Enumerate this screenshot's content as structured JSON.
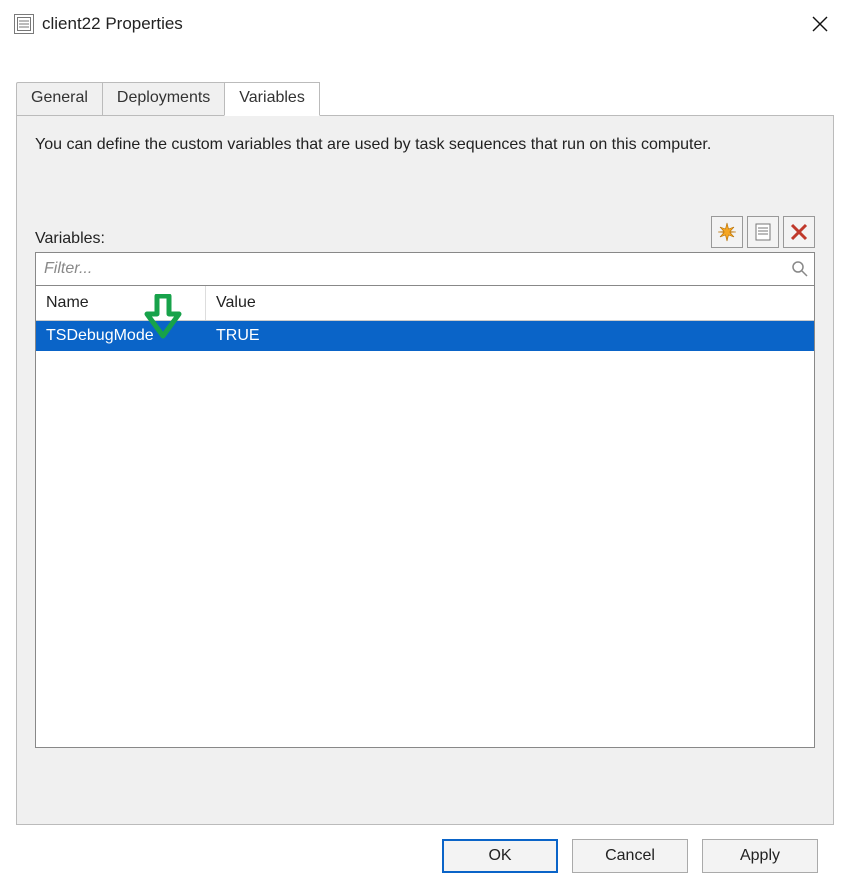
{
  "window": {
    "title": "client22 Properties"
  },
  "tabs": {
    "general": "General",
    "deployments": "Deployments",
    "variables": "Variables",
    "active": "variables"
  },
  "variables_tab": {
    "description": "You can define the custom variables that are used by task sequences that run on this computer.",
    "section_label": "Variables:",
    "filter_placeholder": "Filter...",
    "columns": {
      "name": "Name",
      "value": "Value"
    },
    "rows": [
      {
        "name": "TSDebugMode",
        "value": "TRUE",
        "selected": true
      }
    ],
    "toolbar": {
      "new_tooltip": "New",
      "edit_tooltip": "Edit",
      "delete_tooltip": "Delete"
    }
  },
  "buttons": {
    "ok": "OK",
    "cancel": "Cancel",
    "apply": "Apply"
  }
}
